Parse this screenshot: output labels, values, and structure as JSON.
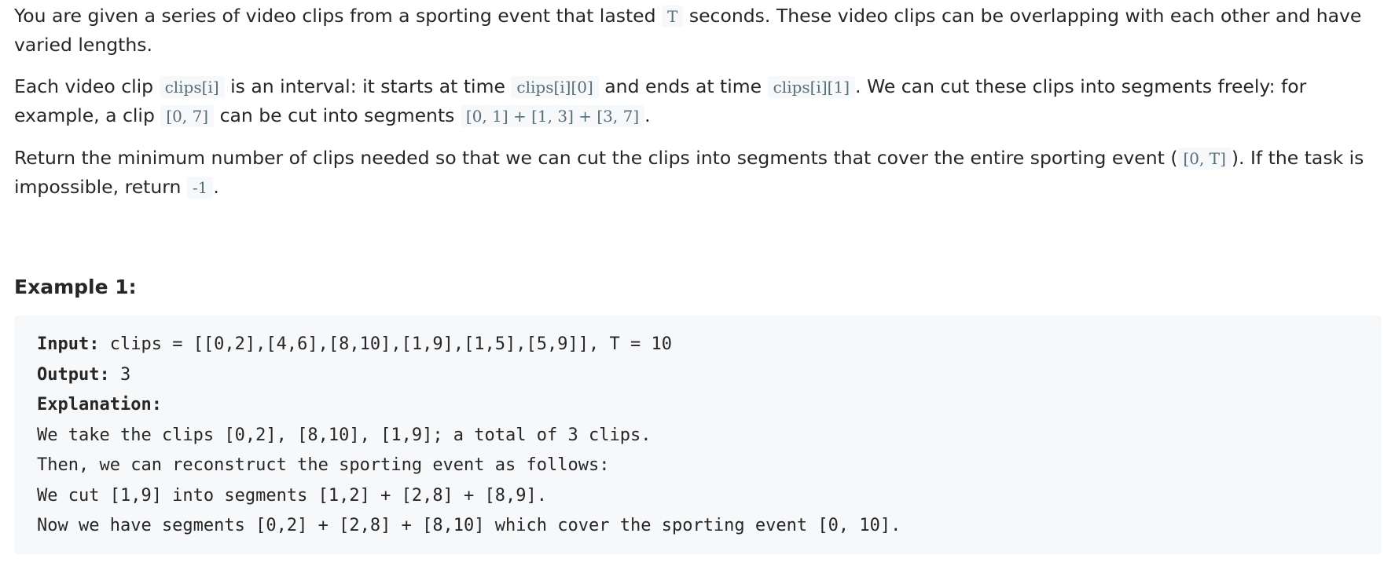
{
  "paragraphs": {
    "p1": {
      "t1": "You are given a series of video clips from a sporting event that lasted ",
      "c1": "T",
      "t2": " seconds.  These video clips can be overlapping with each other and have varied lengths."
    },
    "p2": {
      "t1": "Each video clip ",
      "c1": "clips[i]",
      "t2": " is an interval: it starts at time ",
      "c2": "clips[i][0]",
      "t3": " and ends at time ",
      "c3": "clips[i][1]",
      "t4": ".  We can cut these clips into segments freely: for example, a clip ",
      "c4": "[0, 7]",
      "t5": " can be cut into segments ",
      "c5": "[0, 1] +  [1, 3] + [3, 7]",
      "t6": "."
    },
    "p3": {
      "t1": "Return the minimum number of clips needed so that we can cut the clips into segments that cover the entire sporting event (",
      "c1": "[0, T]",
      "t2": ").  If the task is impossible, return ",
      "c2": "-1",
      "t3": "."
    }
  },
  "example": {
    "title": "Example 1:",
    "input_label": "Input:",
    "input_value": " clips = [[0,2],[4,6],[8,10],[1,9],[1,5],[5,9]], T = 10",
    "output_label": "Output:",
    "output_value": " 3",
    "explanation_label": "Explanation:",
    "explanation_lines": [
      "We take the clips [0,2], [8,10], [1,9]; a total of 3 clips.",
      "Then, we can reconstruct the sporting event as follows:",
      "We cut [1,9] into segments [1,2] + [2,8] + [8,9].",
      "Now we have segments [0,2] + [2,8] + [8,10] which cover the sporting event [0, 10]."
    ]
  }
}
